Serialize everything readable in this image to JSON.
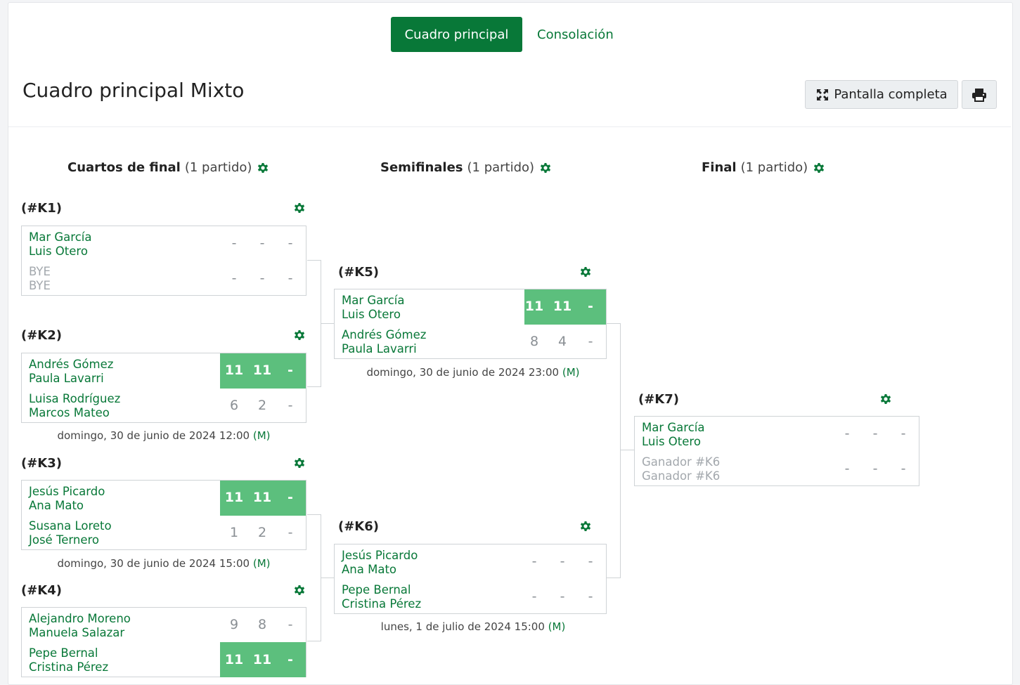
{
  "tabs": {
    "main_label": "Cuadro principal",
    "consolation_label": "Consolación"
  },
  "title": "Cuadro principal Mixto",
  "buttons": {
    "fullscreen_label": "Pantalla completa",
    "print_icon": "print-icon",
    "fullscreen_icon": "expand-icon"
  },
  "colors": {
    "brand_green": "#087838",
    "winner_bg": "#5cbf7d",
    "muted_text": "#a3a8ad"
  },
  "rounds": [
    {
      "name": "Cuartos de final",
      "count": "(1 partido)"
    },
    {
      "name": "Semifinales",
      "count": "(1 partido)"
    },
    {
      "name": "Final",
      "count": "(1 partido)"
    }
  ],
  "matches": {
    "k1": {
      "id": "(#K1)",
      "team1": {
        "p1": "Mar García",
        "p2": "Luis Otero"
      },
      "team2": {
        "p1": "BYE",
        "p2": "BYE"
      },
      "scores1": [
        "-",
        "-",
        "-"
      ],
      "scores2": [
        "-",
        "-",
        "-"
      ],
      "date": "",
      "court": ""
    },
    "k2": {
      "id": "(#K2)",
      "team1": {
        "p1": "Andrés Gómez",
        "p2": "Paula Lavarri"
      },
      "team2": {
        "p1": "Luisa Rodríguez",
        "p2": "Marcos Mateo"
      },
      "scores1": [
        "11",
        "11",
        "-"
      ],
      "scores2": [
        "6",
        "2",
        "-"
      ],
      "date": "domingo, 30 de junio de 2024 12:00",
      "court": "(M)"
    },
    "k3": {
      "id": "(#K3)",
      "team1": {
        "p1": "Jesús Picardo",
        "p2": "Ana Mato"
      },
      "team2": {
        "p1": "Susana Loreto",
        "p2": "José Ternero"
      },
      "scores1": [
        "11",
        "11",
        "-"
      ],
      "scores2": [
        "1",
        "2",
        "-"
      ],
      "date": "domingo, 30 de junio de 2024 15:00",
      "court": "(M)"
    },
    "k4": {
      "id": "(#K4)",
      "team1": {
        "p1": "Alejandro Moreno",
        "p2": "Manuela Salazar"
      },
      "team2": {
        "p1": "Pepe Bernal",
        "p2": "Cristina Pérez"
      },
      "scores1": [
        "9",
        "8",
        "-"
      ],
      "scores2": [
        "11",
        "11",
        "-"
      ],
      "date": "",
      "court": ""
    },
    "k5": {
      "id": "(#K5)",
      "team1": {
        "p1": "Mar García",
        "p2": "Luis Otero"
      },
      "team2": {
        "p1": "Andrés Gómez",
        "p2": "Paula Lavarri"
      },
      "scores1": [
        "11",
        "11",
        "-"
      ],
      "scores2": [
        "8",
        "4",
        "-"
      ],
      "date": "domingo, 30 de junio de 2024 23:00",
      "court": "(M)"
    },
    "k6": {
      "id": "(#K6)",
      "team1": {
        "p1": "Jesús Picardo",
        "p2": "Ana Mato"
      },
      "team2": {
        "p1": "Pepe Bernal",
        "p2": "Cristina Pérez"
      },
      "scores1": [
        "-",
        "-",
        "-"
      ],
      "scores2": [
        "-",
        "-",
        "-"
      ],
      "date": "lunes, 1 de julio de 2024 15:00",
      "court": "(M)"
    },
    "k7": {
      "id": "(#K7)",
      "team1": {
        "p1": "Mar García",
        "p2": "Luis Otero"
      },
      "team2": {
        "p1": "Ganador #K6",
        "p2": "Ganador #K6"
      },
      "scores1": [
        "-",
        "-",
        "-"
      ],
      "scores2": [
        "-",
        "-",
        "-"
      ],
      "date": "",
      "court": ""
    }
  }
}
